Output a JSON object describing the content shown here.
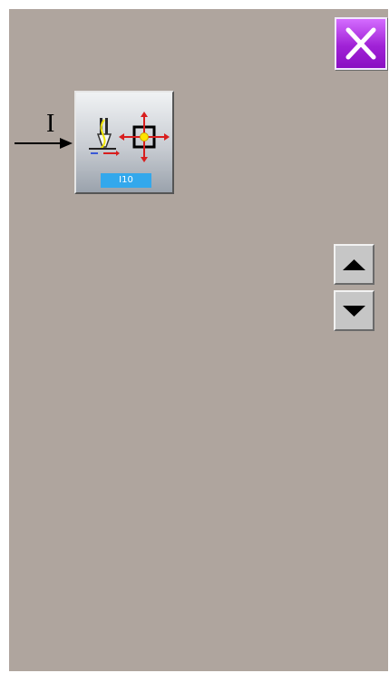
{
  "screen": {
    "background": "#afa59e"
  },
  "close_button": {
    "icon": "close-icon",
    "color": "#a022d6"
  },
  "annotation": {
    "label": "I"
  },
  "function_tile": {
    "icon": "needle-position-adjust-icon",
    "code": "I10",
    "code_color": "#33a8ec"
  },
  "scroll": {
    "up_icon": "triangle-up-icon",
    "down_icon": "triangle-down-icon"
  }
}
